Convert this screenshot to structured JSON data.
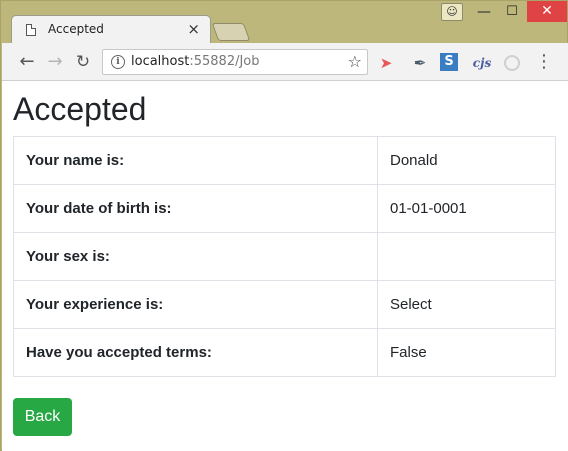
{
  "browser": {
    "tab": {
      "title": "Accepted",
      "close_glyph": "×",
      "icon": "document-icon"
    },
    "window_controls": {
      "minimize": "—",
      "maximize": "☐",
      "close": "✕",
      "user_icon": "user-profile-icon"
    },
    "toolbar": {
      "back_glyph": "←",
      "forward_glyph": "→",
      "reload_glyph": "C",
      "url_host": "localhost",
      "url_rest": ":55882/Job",
      "bookmark_glyph": "☆",
      "menu_glyph": "⋮",
      "extensions": [
        "redirect-extension-icon",
        "feather-extension-icon",
        "s-extension-icon",
        "cjs-extension-icon",
        "circle-extension-icon"
      ],
      "ext_s_label": "S",
      "ext_cjs_label": "cjs"
    }
  },
  "page": {
    "heading": "Accepted",
    "rows": [
      {
        "label": "Your name is:",
        "value": "Donald"
      },
      {
        "label": "Your date of birth is:",
        "value": "01-01-0001"
      },
      {
        "label": "Your sex is:",
        "value": ""
      },
      {
        "label": "Your experience is:",
        "value": "Select"
      },
      {
        "label": "Have you accepted terms:",
        "value": "False"
      }
    ],
    "back_button": "Back"
  },
  "colors": {
    "button_green": "#28a745",
    "close_red": "#e04343",
    "frame": "#bdb77c"
  }
}
